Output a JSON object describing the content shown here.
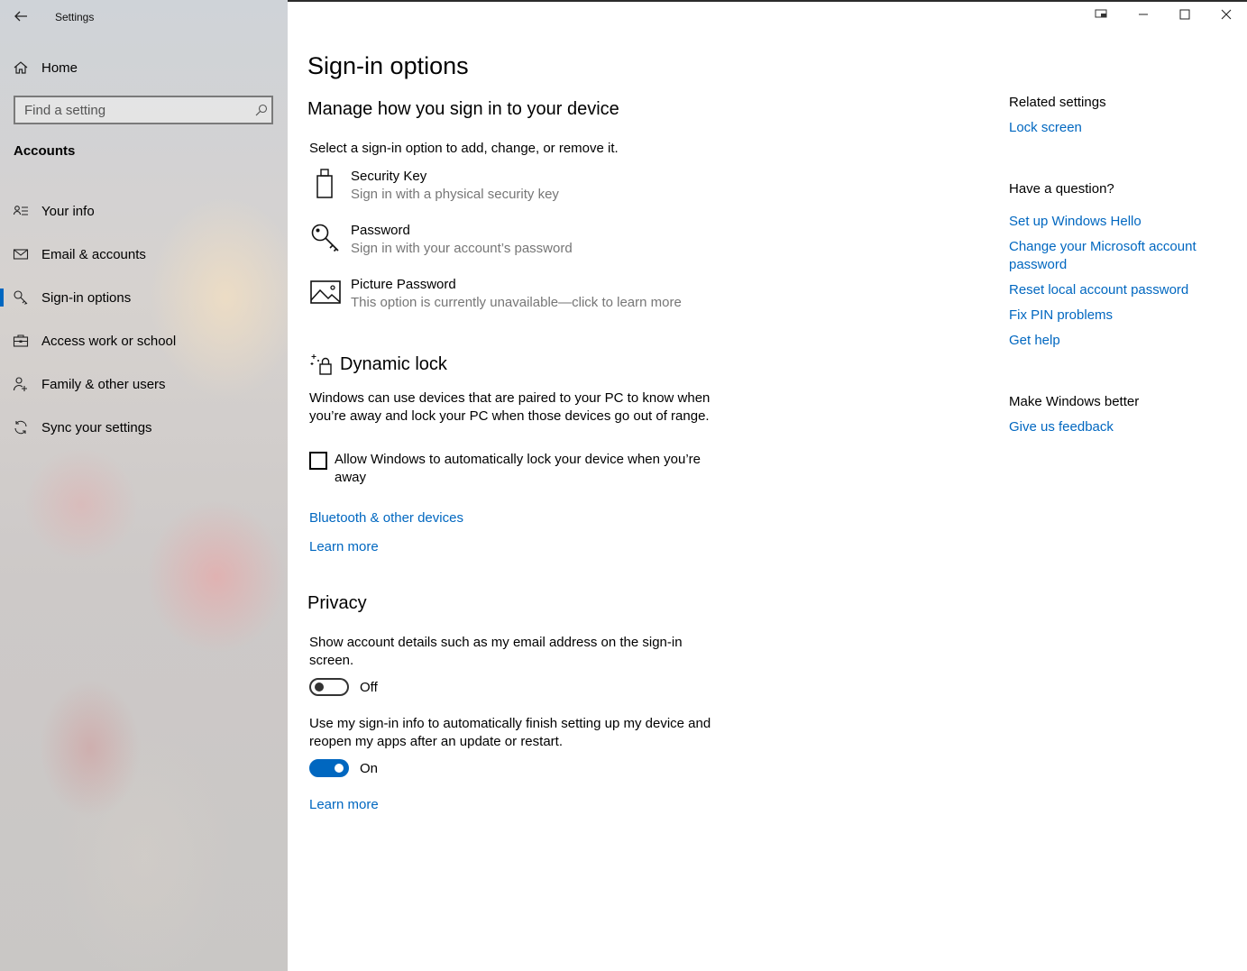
{
  "window": {
    "title": "Settings"
  },
  "sidebar": {
    "home_label": "Home",
    "search_placeholder": "Find a setting",
    "section": "Accounts",
    "items": [
      {
        "label": "Your info",
        "icon": "contact-card-icon"
      },
      {
        "label": "Email & accounts",
        "icon": "mail-icon"
      },
      {
        "label": "Sign-in options",
        "icon": "key-icon",
        "active": true
      },
      {
        "label": "Access work or school",
        "icon": "briefcase-icon"
      },
      {
        "label": "Family & other users",
        "icon": "person-add-icon"
      },
      {
        "label": "Sync your settings",
        "icon": "sync-icon"
      }
    ]
  },
  "main": {
    "title": "Sign-in options",
    "subtitle": "Manage how you sign in to your device",
    "description": "Select a sign-in option to add, change, or remove it.",
    "options": [
      {
        "title": "Security Key",
        "desc": "Sign in with a physical security key",
        "icon": "usb-key-icon"
      },
      {
        "title": "Password",
        "desc": "Sign in with your account’s password",
        "icon": "key-icon"
      },
      {
        "title": "Picture Password",
        "desc": "This option is currently unavailable—click to learn more",
        "icon": "picture-icon"
      }
    ],
    "dynamic_lock": {
      "title": "Dynamic lock",
      "description": "Windows can use devices that are paired to your PC to know when you’re away and lock your PC when those devices go out of range.",
      "checkbox_label": "Allow Windows to automatically lock your device when you’re away",
      "checkbox_checked": false,
      "link_bluetooth": "Bluetooth & other devices",
      "link_learn_more": "Learn more"
    },
    "privacy": {
      "title": "Privacy",
      "setting1": "Show account details such as my email address on the sign-in screen.",
      "toggle1_state": "Off",
      "setting2": "Use my sign-in info to automatically finish setting up my device and reopen my apps after an update or restart.",
      "toggle2_state": "On",
      "link_learn_more": "Learn more"
    }
  },
  "right": {
    "related_heading": "Related settings",
    "related_link": "Lock screen",
    "question_heading": "Have a question?",
    "question_links": [
      "Set up Windows Hello",
      "Change your Microsoft account password",
      "Reset local account password",
      "Fix PIN problems",
      "Get help"
    ],
    "better_heading": "Make Windows better",
    "feedback_link": "Give us feedback"
  },
  "colors": {
    "accent": "#0067c0",
    "secondary_text": "#767676"
  }
}
